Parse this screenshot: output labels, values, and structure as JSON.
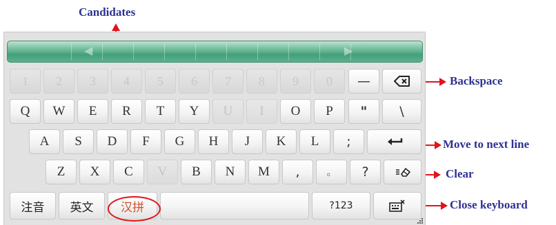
{
  "annotations": {
    "candidates": "Candidates",
    "backspace": "Backspace",
    "move_next_line": "Move to next line",
    "clear": "Clear",
    "close_keyboard": "Close keyboard"
  },
  "colors": {
    "annotation_text": "#2e3192",
    "annotation_arrow": "#e3131b",
    "candidate_bar": "#43a07a",
    "active_mode": "#d4502c"
  },
  "candidate_bar": {
    "prev_icon": "triangle-left-icon",
    "next_icon": "triangle-right-icon"
  },
  "keyboard": {
    "row1": [
      "1",
      "2",
      "3",
      "4",
      "5",
      "6",
      "7",
      "8",
      "9",
      "0",
      "—"
    ],
    "backspace_icon": "backspace-icon",
    "row2": [
      "Q",
      "W",
      "E",
      "R",
      "T",
      "Y",
      "U",
      "I",
      "O",
      "P",
      "\"",
      "\\"
    ],
    "row3": [
      "A",
      "S",
      "D",
      "F",
      "G",
      "H",
      "J",
      "K",
      "L",
      ";"
    ],
    "enter_icon": "enter-icon",
    "row4": [
      "Z",
      "X",
      "C",
      "V",
      "B",
      "N",
      "M",
      ",",
      "。",
      "?"
    ],
    "clear_icon": "clear-eraser-icon",
    "row5": {
      "zhuyin": "注音",
      "english": "英文",
      "hanpin": "汉拼",
      "symbols": "?123"
    },
    "close_icon": "close-keyboard-icon"
  }
}
